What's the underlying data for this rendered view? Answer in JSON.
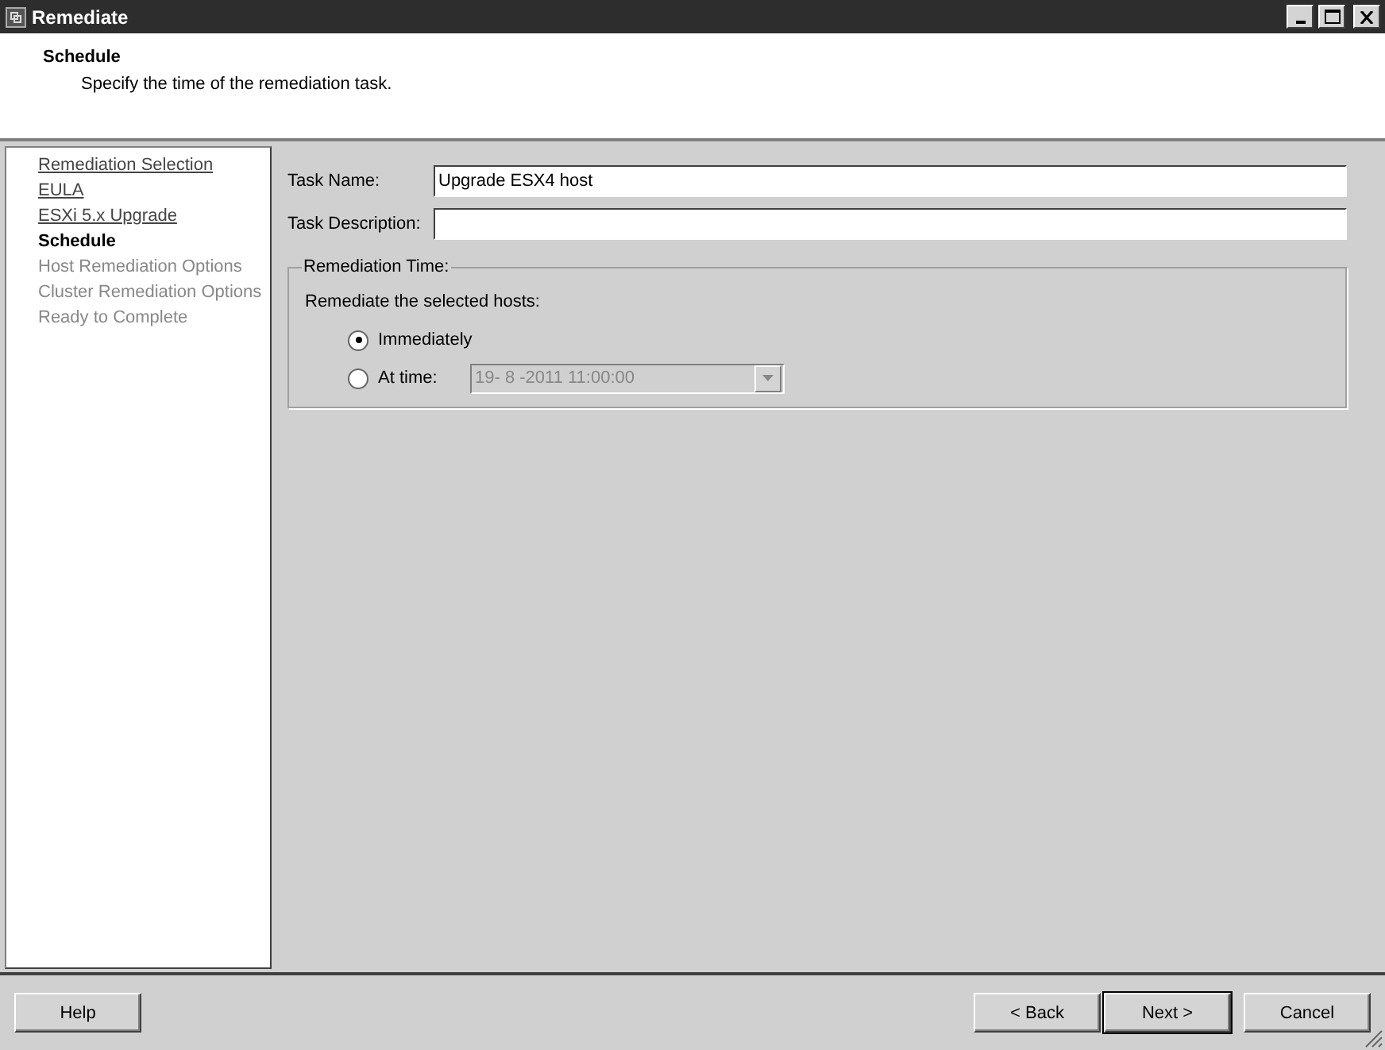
{
  "window": {
    "title": "Remediate"
  },
  "header": {
    "title": "Schedule",
    "subtitle": "Specify the time of the remediation task."
  },
  "steps": [
    {
      "label": "Remediation Selection",
      "kind": "done"
    },
    {
      "label": "EULA",
      "kind": "done"
    },
    {
      "label": "ESXi 5.x Upgrade",
      "kind": "done"
    },
    {
      "label": "Schedule",
      "kind": "current"
    },
    {
      "label": "Host Remediation Options",
      "kind": "pending"
    },
    {
      "label": "Cluster Remediation Options",
      "kind": "pending"
    },
    {
      "label": "Ready to Complete",
      "kind": "pending"
    }
  ],
  "fields": [
    {
      "label": "Task Name:",
      "value": "Upgrade ESX4 host"
    },
    {
      "label": "Task Description:"
    }
  ],
  "remediation_time": {
    "legend": "Remediation Time:",
    "prompt": "Remediate the selected hosts:",
    "options": [
      {
        "label": "Immediately",
        "selected": true
      },
      {
        "label": "At time:",
        "selected": false,
        "date_value": "19- 8 -2011 11:00:00",
        "date_disabled": true
      }
    ]
  },
  "buttons_left": [
    "Help"
  ],
  "buttons_right": [
    {
      "label": "< Back",
      "default": false
    },
    {
      "label": "Next >",
      "default": true
    },
    {
      "label": "Cancel",
      "default": false
    }
  ]
}
